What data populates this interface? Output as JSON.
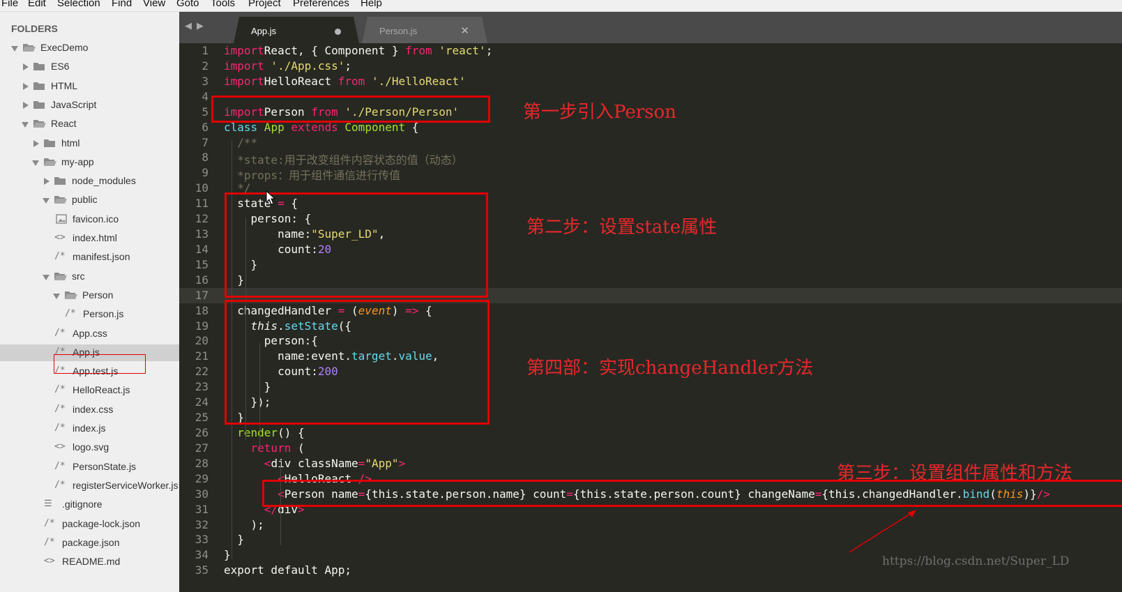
{
  "menu": [
    "File",
    "Edit",
    "Selection",
    "Find",
    "View",
    "Goto",
    "Tools",
    "Project",
    "Preferences",
    "Help"
  ],
  "sidebar": {
    "title": "FOLDERS",
    "items": [
      {
        "label": "ExecDemo",
        "type": "folder",
        "state": "open"
      },
      {
        "label": "ES6",
        "type": "folder",
        "state": "closed"
      },
      {
        "label": "HTML",
        "type": "folder",
        "state": "closed"
      },
      {
        "label": "JavaScript",
        "type": "folder",
        "state": "closed"
      },
      {
        "label": "React",
        "type": "folder",
        "state": "open"
      },
      {
        "label": "html",
        "type": "folder",
        "state": "closed"
      },
      {
        "label": "my-app",
        "type": "folder",
        "state": "open"
      },
      {
        "label": "node_modules",
        "type": "folder",
        "state": "closed"
      },
      {
        "label": "public",
        "type": "folder",
        "state": "open"
      },
      {
        "label": "favicon.ico",
        "type": "image"
      },
      {
        "label": "index.html",
        "type": "markup"
      },
      {
        "label": "manifest.json",
        "type": "script"
      },
      {
        "label": "src",
        "type": "folder",
        "state": "open"
      },
      {
        "label": "Person",
        "type": "folder",
        "state": "open"
      },
      {
        "label": "Person.js",
        "type": "script"
      },
      {
        "label": "App.css",
        "type": "script"
      },
      {
        "label": "App.js",
        "type": "script",
        "selected": true
      },
      {
        "label": "App.test.js",
        "type": "script"
      },
      {
        "label": "HelloReact.js",
        "type": "script"
      },
      {
        "label": "index.css",
        "type": "script"
      },
      {
        "label": "index.js",
        "type": "script"
      },
      {
        "label": "logo.svg",
        "type": "markup"
      },
      {
        "label": "PersonState.js",
        "type": "script"
      },
      {
        "label": "registerServiceWorker.js",
        "type": "script"
      },
      {
        "label": ".gitignore",
        "type": "text"
      },
      {
        "label": "package-lock.json",
        "type": "script"
      },
      {
        "label": "package.json",
        "type": "script"
      },
      {
        "label": "README.md",
        "type": "markup"
      }
    ]
  },
  "tabs": [
    {
      "label": "App.js",
      "active": true,
      "modified": true
    },
    {
      "label": "Person.js",
      "active": false,
      "modified": false
    }
  ],
  "editor": {
    "current_line": 17,
    "lines": [
      [
        [
          "k",
          "import"
        ],
        [
          "",
          "React, { Component } "
        ],
        [
          "k",
          "from"
        ],
        [
          "",
          ""
        ],
        [
          "s",
          " 'react'"
        ],
        [
          "",
          ";"
        ]
      ],
      [
        [
          "k",
          "import"
        ],
        [
          "s",
          " './App.css'"
        ],
        [
          "",
          ";"
        ]
      ],
      [
        [
          "k",
          "import"
        ],
        [
          "",
          ""
        ],
        [
          "",
          "HelloReact "
        ],
        [
          "k",
          "from"
        ],
        [
          "s",
          " './HelloReact'"
        ]
      ],
      [],
      [
        [
          "k",
          "import"
        ],
        [
          "",
          "Person "
        ],
        [
          "k",
          "from"
        ],
        [
          "s",
          " './Person/Person'"
        ]
      ],
      [
        [
          "f",
          "class"
        ],
        [
          "t",
          " App "
        ],
        [
          "k",
          "extends"
        ],
        [
          "t",
          " Component"
        ],
        [
          "",
          " {"
        ]
      ],
      [
        [
          "c",
          "  /**"
        ]
      ],
      [
        [
          "c",
          "  *state:用于改变组件内容状态的值（动态）"
        ]
      ],
      [
        [
          "c",
          "  *props：用于组件通信进行传值"
        ]
      ],
      [
        [
          "c",
          "  */"
        ]
      ],
      [
        [
          "",
          "  state"
        ],
        [
          "o",
          " ="
        ],
        [
          "",
          " {"
        ]
      ],
      [
        [
          "",
          "    person: {"
        ]
      ],
      [
        [
          "",
          "        name:"
        ],
        [
          "s",
          "\"Super_LD\""
        ],
        [
          "",
          ","
        ]
      ],
      [
        [
          "",
          "        count:"
        ],
        [
          "n",
          "20"
        ]
      ],
      [
        [
          "",
          "    }"
        ]
      ],
      [
        [
          "",
          "  }"
        ]
      ],
      [],
      [
        [
          "",
          "  changedHandler "
        ],
        [
          "o",
          "="
        ],
        [
          "",
          " ("
        ],
        [
          "v",
          "event"
        ],
        [
          "",
          ") "
        ],
        [
          "o",
          "=>"
        ],
        [
          "",
          " {"
        ]
      ],
      [
        [
          "i",
          "    this"
        ],
        [
          "",
          ".",
          "x"
        ],
        [
          "f",
          "setState"
        ],
        [
          "",
          "({"
        ]
      ],
      [
        [
          "",
          "      person:{"
        ]
      ],
      [
        [
          "",
          "        name:event."
        ],
        [
          "f",
          "target"
        ],
        [
          "",
          "."
        ],
        [
          "f",
          "value"
        ],
        [
          "",
          ","
        ]
      ],
      [
        [
          "",
          "        count:"
        ],
        [
          "n",
          "200"
        ]
      ],
      [
        [
          "",
          "      }"
        ]
      ],
      [
        [
          "",
          "    });"
        ]
      ],
      [
        [
          "",
          "  }"
        ]
      ],
      [
        [
          "t",
          "  render"
        ],
        [
          "",
          "() {"
        ]
      ],
      [
        [
          "k",
          "    return"
        ],
        [
          "",
          " ("
        ]
      ],
      [
        [
          "",
          "      "
        ],
        [
          "k",
          "<"
        ],
        [
          "",
          "div className"
        ],
        [
          "o",
          "="
        ],
        [
          "s",
          "\"App\""
        ],
        [
          "k",
          ">"
        ]
      ],
      [
        [
          "",
          "        "
        ],
        [
          "k",
          "<"
        ],
        [
          "",
          "HelloReact "
        ],
        [
          "k",
          "/>"
        ]
      ],
      [
        [
          "",
          "        "
        ],
        [
          "k",
          "<"
        ],
        [
          "",
          "Person name"
        ],
        [
          "o",
          "="
        ],
        [
          "",
          "{this.state.person.name} count"
        ],
        [
          "o",
          "="
        ],
        [
          "",
          "{this.state.person.count} changeName"
        ],
        [
          "o",
          "="
        ],
        [
          "",
          "{this.changedHandler."
        ],
        [
          "f",
          "bind"
        ],
        [
          "",
          "("
        ],
        [
          "v",
          "this"
        ],
        [
          "",
          ")}"
        ],
        [
          "k",
          "/>"
        ]
      ],
      [
        [
          "",
          "      "
        ],
        [
          "k",
          "</"
        ],
        [
          "",
          "div"
        ],
        [
          "k",
          ">"
        ]
      ],
      [
        [
          "",
          "    );"
        ]
      ],
      [
        [
          "",
          "  }"
        ]
      ],
      [
        [
          "",
          "}"
        ]
      ],
      [
        [
          "",
          "export default App;"
        ]
      ]
    ]
  },
  "annotations": {
    "step1": "第一步引入Person",
    "step2": "第二步：设置state属性",
    "step4": "第四部：实现changeHandler方法",
    "step3": "第三步：设置组件属性和方法"
  },
  "watermark": "https://blog.csdn.net/Super_LD",
  "colors": {
    "accent_red": "#e00000",
    "editor_bg": "#272822",
    "sidebar_bg": "#efefef"
  }
}
